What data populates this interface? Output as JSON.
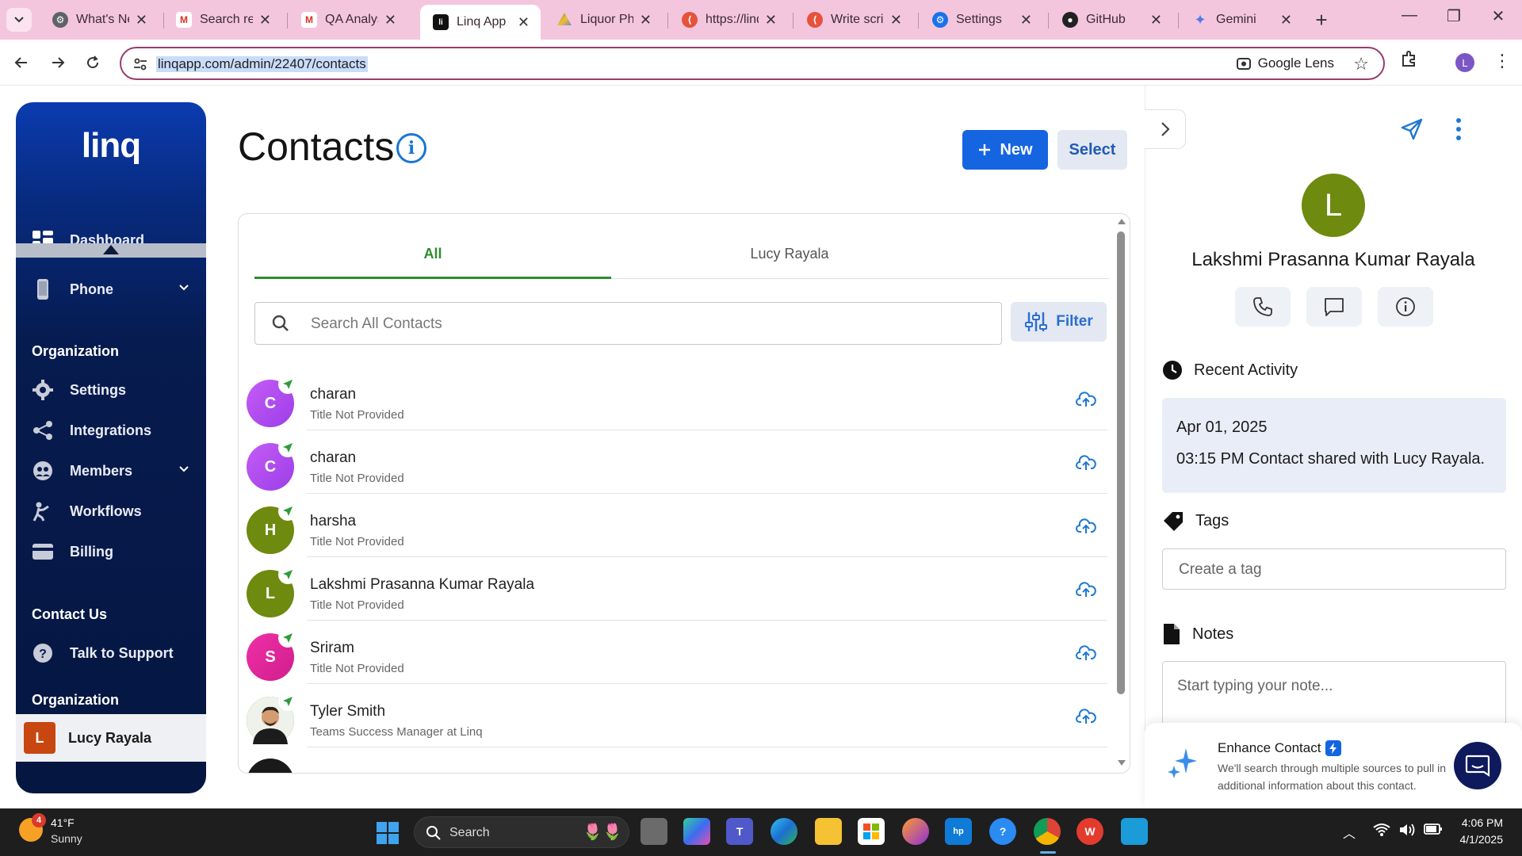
{
  "browser": {
    "tabs": [
      {
        "label": "What's Ne",
        "favicon": "gear-icon",
        "active": false
      },
      {
        "label": "Search res",
        "favicon": "gmail-icon",
        "active": false
      },
      {
        "label": "QA Analys",
        "favicon": "gmail-icon",
        "active": false
      },
      {
        "label": "Linq App",
        "favicon": "linq-icon",
        "active": true
      },
      {
        "label": "Liquor Pho",
        "favicon": "drive-icon",
        "active": false
      },
      {
        "label": "https://linq",
        "favicon": "script-icon",
        "active": false
      },
      {
        "label": "Write scrip",
        "favicon": "script-icon",
        "active": false
      },
      {
        "label": "Settings",
        "favicon": "gear-icon",
        "active": false
      },
      {
        "label": "GitHub",
        "favicon": "github-icon",
        "active": false
      },
      {
        "label": "Gemini",
        "favicon": "gemini-icon",
        "active": false
      }
    ],
    "url": "linqapp.com/admin/22407/contacts",
    "lens_label": "Google Lens",
    "profile_initial": "L"
  },
  "sidebar": {
    "logo": "linq",
    "items": [
      {
        "label": "Dashboard",
        "icon": "dashboard-icon"
      },
      {
        "label": "Phone",
        "icon": "phone-icon"
      }
    ],
    "org_heading": "Organization",
    "org_items": [
      {
        "label": "Settings",
        "icon": "gear-icon"
      },
      {
        "label": "Integrations",
        "icon": "share-icon"
      },
      {
        "label": "Members",
        "icon": "members-icon"
      },
      {
        "label": "Workflows",
        "icon": "workflow-icon"
      },
      {
        "label": "Billing",
        "icon": "card-icon"
      }
    ],
    "contact_heading": "Contact Us",
    "support_label": "Talk to Support",
    "org_heading_2": "Organization",
    "user_initial": "L",
    "user_name": "Lucy Rayala"
  },
  "main": {
    "title": "Contacts",
    "new_label": "New",
    "select_label": "Select",
    "tabs": [
      "All",
      "Lucy Rayala"
    ],
    "search_placeholder": "Search All Contacts",
    "filter_label": "Filter",
    "contacts": [
      {
        "initial": "C",
        "name": "charan",
        "subtitle": "Title Not Provided",
        "color": "#b84cf0"
      },
      {
        "initial": "C",
        "name": "charan",
        "subtitle": "Title Not Provided",
        "color": "#b84cf0"
      },
      {
        "initial": "H",
        "name": "harsha",
        "subtitle": "Title Not Provided",
        "color": "#6e8a0f"
      },
      {
        "initial": "L",
        "name": "Lakshmi Prasanna Kumar Rayala",
        "subtitle": "Title Not Provided",
        "color": "#6e8a0f"
      },
      {
        "initial": "S",
        "name": "Sriram",
        "subtitle": "Title Not Provided",
        "color": "#e0259c"
      },
      {
        "initial": "",
        "name": "Tyler Smith",
        "subtitle": "Teams Success Manager at Linq",
        "color": "#3b4a3a"
      }
    ]
  },
  "panel": {
    "avatar_initial": "L",
    "name": "Lakshmi Prasanna Kumar Rayala",
    "recent_activity_heading": "Recent Activity",
    "activity_date": "Apr 01, 2025",
    "activity_text": "03:15 PM  Contact shared with Lucy Rayala.",
    "tags_heading": "Tags",
    "tag_placeholder": "Create a tag",
    "notes_heading": "Notes",
    "note_placeholder": "Start typing your note...",
    "enhance_title": "Enhance Contact",
    "enhance_desc": "We'll search through multiple sources to pull in additional information about this contact."
  },
  "taskbar": {
    "weather_badge": "4",
    "weather_temp": "41°F",
    "weather_cond": "Sunny",
    "search_label": "Search",
    "time": "4:06 PM",
    "date": "4/1/2025"
  },
  "colors": {
    "accent": "#1565e0",
    "tab_green": "#2e8b2e",
    "sidebar_navy": "#061b4f",
    "browser_pink": "#f4c6de"
  }
}
